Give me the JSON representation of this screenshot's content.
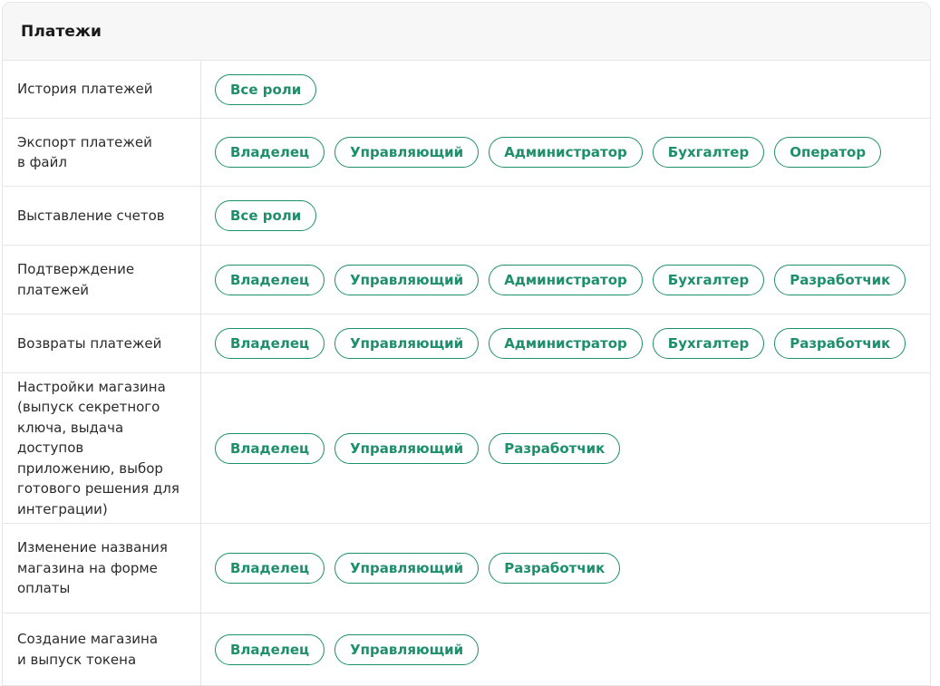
{
  "section": {
    "title": "Платежи"
  },
  "rows": [
    {
      "label": "История платежей",
      "roles": [
        "Все роли"
      ]
    },
    {
      "label": "Экспорт платежей\nв файл",
      "roles": [
        "Владелец",
        "Управляющий",
        "Администратор",
        "Бухгалтер",
        "Оператор"
      ]
    },
    {
      "label": "Выставление счетов",
      "roles": [
        "Все роли"
      ]
    },
    {
      "label": "Подтверждение\nплатежей",
      "roles": [
        "Владелец",
        "Управляющий",
        "Администратор",
        "Бухгалтер",
        "Разработчик"
      ]
    },
    {
      "label": "Возвраты платежей",
      "roles": [
        "Владелец",
        "Управляющий",
        "Администратор",
        "Бухгалтер",
        "Разработчик"
      ]
    },
    {
      "label": "Настройки магазина\n(выпуск секретного\nключа, выдача доступов\nприложению, выбор\nготового решения для\nинтеграции)",
      "roles": [
        "Владелец",
        "Управляющий",
        "Разработчик"
      ]
    },
    {
      "label": "Изменение названия\nмагазина на форме\nоплаты",
      "roles": [
        "Владелец",
        "Управляющий",
        "Разработчик"
      ]
    },
    {
      "label": "Создание магазина\nи выпуск токена",
      "roles": [
        "Владелец",
        "Управляющий"
      ]
    }
  ],
  "colors": {
    "accent": "#1e8f6b",
    "border": "#e6e6e6",
    "header_bg": "#f7f7f7"
  }
}
